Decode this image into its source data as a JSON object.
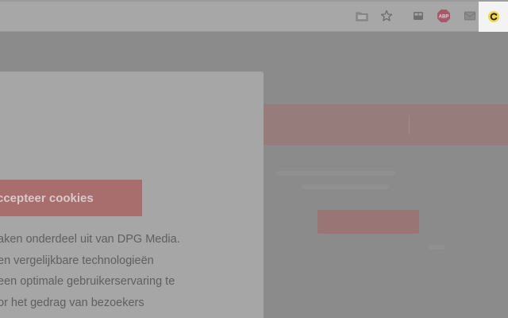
{
  "toolbar": {
    "icons": [
      "folder-icon",
      "star-icon",
      "extension-icon",
      "adblock-icon",
      "mail-icon",
      "refresh-extension-icon"
    ],
    "badge_text": "ABP"
  },
  "cookie_modal": {
    "accept_label": "ccepteer cookies",
    "body_lines": [
      "aken onderdeel uit van DPG Media.",
      "en vergelijkbare technologieën",
      "een optimale gebruikerservaring te",
      "or het gedrag van bezoekers"
    ]
  },
  "colors": {
    "overlay": "#8b8b8b",
    "modal": "#a6a6a6",
    "accept": "#a86d6d",
    "active_extension": "#f3f3f3"
  }
}
